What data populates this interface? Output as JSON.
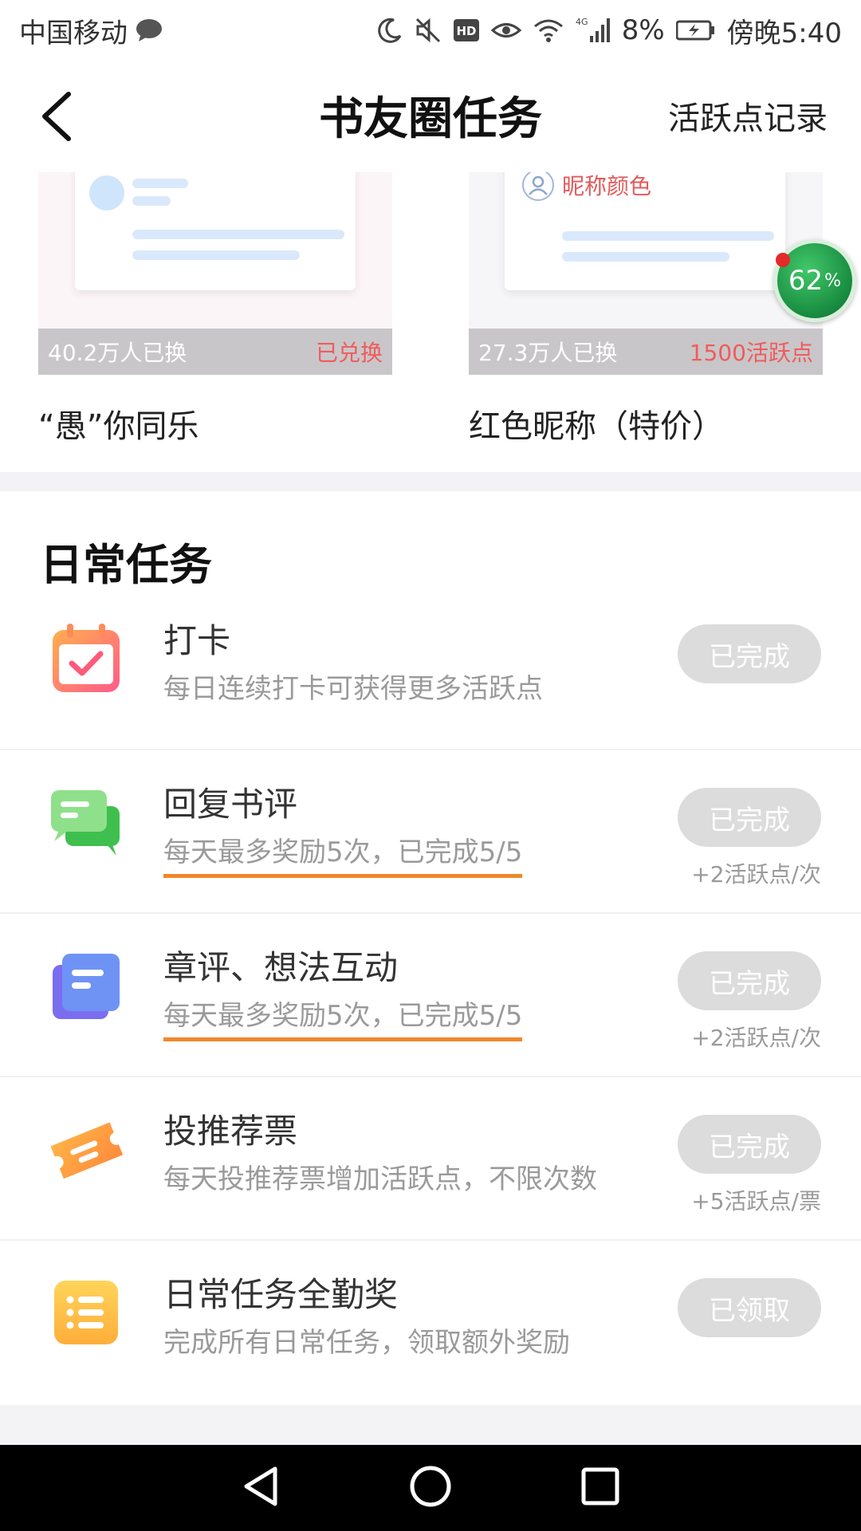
{
  "status_bar": {
    "carrier": "中国移动",
    "battery_percent": "8%",
    "time": "傍晚5:40",
    "network": "4G",
    "hd": "HD"
  },
  "nav": {
    "title": "书友圈任务",
    "action": "活跃点记录"
  },
  "rewards": [
    {
      "count": "40.2万人已换",
      "status": "已兑换",
      "name": "“愚”你同乐"
    },
    {
      "count": "27.3万人已换",
      "status": "1500活跃点",
      "name": "红色昵称（特价）",
      "preview_label": "昵称颜色"
    }
  ],
  "floating_badge": {
    "value": "62",
    "unit": "%"
  },
  "daily": {
    "title": "日常任务",
    "tasks": [
      {
        "title": "打卡",
        "desc": "每日连续打卡可获得更多活跃点",
        "button": "已完成",
        "bonus": ""
      },
      {
        "title": "回复书评",
        "desc": "每天最多奖励5次，已完成5/5",
        "button": "已完成",
        "bonus": "+2活跃点/次"
      },
      {
        "title": "章评、想法互动",
        "desc": "每天最多奖励5次，已完成5/5",
        "button": "已完成",
        "bonus": "+2活跃点/次"
      },
      {
        "title": "投推荐票",
        "desc": "每天投推荐票增加活跃点，不限次数",
        "button": "已完成",
        "bonus": "+5活跃点/票"
      },
      {
        "title": "日常任务全勤奖",
        "desc": "完成所有日常任务，领取额外奖励",
        "button": "已领取",
        "bonus": ""
      }
    ]
  }
}
